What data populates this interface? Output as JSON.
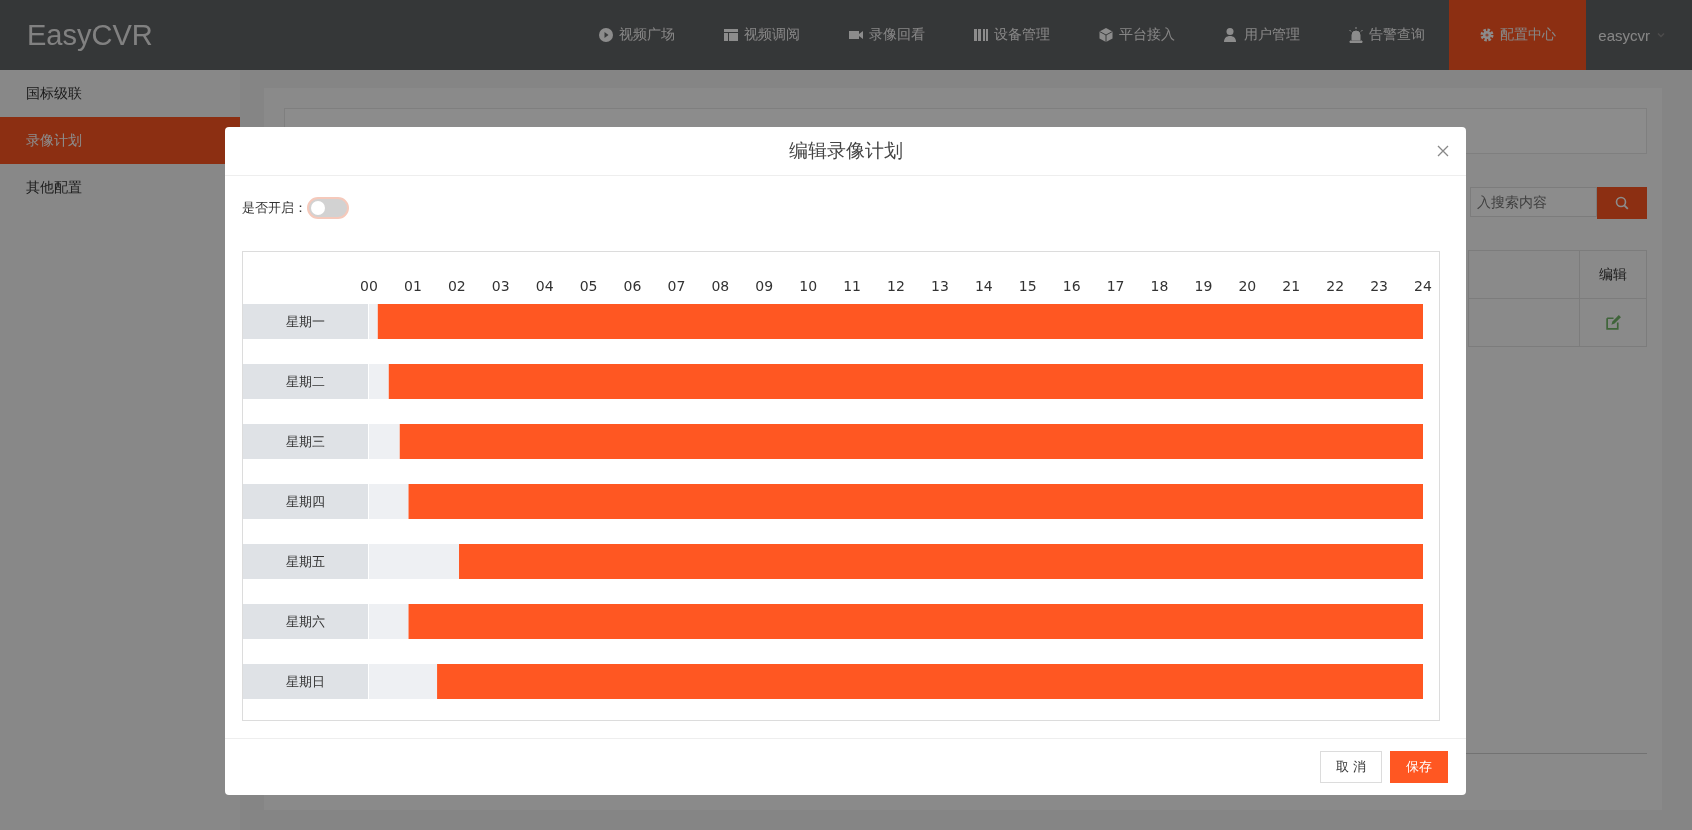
{
  "app": {
    "logo": "EasyCVR",
    "nav": [
      {
        "label": "视频广场",
        "selected": false
      },
      {
        "label": "视频调阅",
        "selected": false
      },
      {
        "label": "录像回看",
        "selected": false
      },
      {
        "label": "设备管理",
        "selected": false
      },
      {
        "label": "平台接入",
        "selected": false
      },
      {
        "label": "用户管理",
        "selected": false
      },
      {
        "label": "告警查询",
        "selected": false
      },
      {
        "label": "配置中心",
        "selected": true
      }
    ],
    "user": "easycvr"
  },
  "sidebar": {
    "items": [
      {
        "label": "国标级联",
        "selected": false
      },
      {
        "label": "录像计划",
        "selected": true
      },
      {
        "label": "其他配置",
        "selected": false
      }
    ]
  },
  "page": {
    "search": {
      "placeholder": "入搜索内容"
    },
    "table": {
      "columns": [
        "编辑"
      ]
    }
  },
  "dialog": {
    "title": "编辑录像计划",
    "toggle": {
      "label": "是否开启：",
      "on": false
    },
    "schedule": {
      "chart_data": {
        "type": "bar",
        "orientation": "horizontal",
        "stacked": true,
        "categories": [
          "星期一",
          "星期二",
          "星期三",
          "星期四",
          "星期五",
          "星期六",
          "星期日"
        ],
        "series": [
          {
            "color": "#eef0f3",
            "values": [
              0.2,
              0.45,
              0.7,
              0.9,
              2.05,
              0.9,
              1.55
            ]
          },
          {
            "color": "#ff5722",
            "values": [
              23.8,
              23.55,
              23.3,
              23.1,
              21.95,
              23.1,
              22.45
            ]
          }
        ],
        "xlim": [
          0,
          24
        ],
        "xticks": [
          {
            "value": 0,
            "label": "00"
          },
          {
            "value": 1,
            "label": "01"
          },
          {
            "value": 2,
            "label": "02"
          },
          {
            "value": 3,
            "label": "03"
          },
          {
            "value": 4,
            "label": "04"
          },
          {
            "value": 5,
            "label": "05"
          },
          {
            "value": 6,
            "label": "06"
          },
          {
            "value": 7,
            "label": "07"
          },
          {
            "value": 8,
            "label": "08"
          },
          {
            "value": 9,
            "label": "09"
          },
          {
            "value": 10,
            "label": "10"
          },
          {
            "value": 11,
            "label": "11"
          },
          {
            "value": 12,
            "label": "12"
          },
          {
            "value": 13,
            "label": "13"
          },
          {
            "value": 14,
            "label": "14"
          },
          {
            "value": 15,
            "label": "15"
          },
          {
            "value": 16,
            "label": "16"
          },
          {
            "value": 17,
            "label": "17"
          },
          {
            "value": 18,
            "label": "18"
          },
          {
            "value": 19,
            "label": "19"
          },
          {
            "value": 20,
            "label": "20"
          },
          {
            "value": 21,
            "label": "21"
          },
          {
            "value": 22,
            "label": "22"
          },
          {
            "value": 23,
            "label": "23"
          },
          {
            "value": 24,
            "label": "24"
          }
        ]
      }
    },
    "buttons": [
      {
        "label": "取 消",
        "kind": "default"
      },
      {
        "label": "保存",
        "kind": "primary"
      }
    ]
  }
}
